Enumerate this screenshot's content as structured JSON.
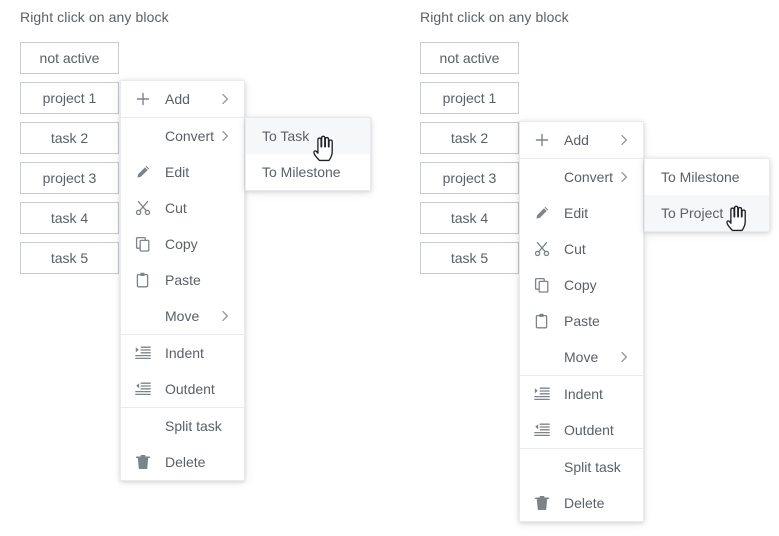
{
  "panels": [
    {
      "id": "left",
      "hint": "Right click on any block",
      "blocks": [
        {
          "label": "not active"
        },
        {
          "label": "project 1"
        },
        {
          "label": "task 2"
        },
        {
          "label": "project 3"
        },
        {
          "label": "task 4"
        },
        {
          "label": "task 5"
        }
      ],
      "menu": {
        "groups": [
          {
            "items": [
              {
                "label": "Add",
                "icon": "plus-icon",
                "arrow": true,
                "highlighted": false
              }
            ]
          },
          {
            "items": [
              {
                "label": "Convert",
                "icon": "none",
                "arrow": true,
                "highlighted": false
              },
              {
                "label": "Edit",
                "icon": "pencil-icon",
                "arrow": false,
                "highlighted": false
              },
              {
                "label": "Cut",
                "icon": "scissors-icon",
                "arrow": false,
                "highlighted": false
              },
              {
                "label": "Copy",
                "icon": "copy-icon",
                "arrow": false,
                "highlighted": false
              },
              {
                "label": "Paste",
                "icon": "clipboard-icon",
                "arrow": false,
                "highlighted": false
              },
              {
                "label": "Move",
                "icon": "none",
                "arrow": true,
                "highlighted": false
              }
            ]
          },
          {
            "items": [
              {
                "label": "Indent",
                "icon": "indent-icon",
                "arrow": false,
                "highlighted": false
              },
              {
                "label": "Outdent",
                "icon": "outdent-icon",
                "arrow": false,
                "highlighted": false
              }
            ]
          },
          {
            "items": [
              {
                "label": "Split task",
                "icon": "none",
                "arrow": false,
                "highlighted": false
              },
              {
                "label": "Delete",
                "icon": "trash-icon",
                "arrow": false,
                "highlighted": false
              }
            ]
          }
        ]
      },
      "submenu": {
        "parent": "Convert",
        "items": [
          {
            "label": "To Task",
            "highlighted": true
          },
          {
            "label": "To Milestone",
            "highlighted": false
          }
        ]
      },
      "cursor": {
        "icon": "pointing-hand-cursor",
        "on": "To Task"
      }
    },
    {
      "id": "right",
      "hint": "Right click on any block",
      "blocks": [
        {
          "label": "not active"
        },
        {
          "label": "project 1"
        },
        {
          "label": "task 2"
        },
        {
          "label": "project 3"
        },
        {
          "label": "task 4"
        },
        {
          "label": "task 5"
        }
      ],
      "menu": {
        "groups": [
          {
            "items": [
              {
                "label": "Add",
                "icon": "plus-icon",
                "arrow": true,
                "highlighted": false
              }
            ]
          },
          {
            "items": [
              {
                "label": "Convert",
                "icon": "none",
                "arrow": true,
                "highlighted": false
              },
              {
                "label": "Edit",
                "icon": "pencil-icon",
                "arrow": false,
                "highlighted": false
              },
              {
                "label": "Cut",
                "icon": "scissors-icon",
                "arrow": false,
                "highlighted": false
              },
              {
                "label": "Copy",
                "icon": "copy-icon",
                "arrow": false,
                "highlighted": false
              },
              {
                "label": "Paste",
                "icon": "clipboard-icon",
                "arrow": false,
                "highlighted": false
              },
              {
                "label": "Move",
                "icon": "none",
                "arrow": true,
                "highlighted": false
              }
            ]
          },
          {
            "items": [
              {
                "label": "Indent",
                "icon": "indent-icon",
                "arrow": false,
                "highlighted": false
              },
              {
                "label": "Outdent",
                "icon": "outdent-icon",
                "arrow": false,
                "highlighted": false
              }
            ]
          },
          {
            "items": [
              {
                "label": "Split task",
                "icon": "none",
                "arrow": false,
                "highlighted": false
              },
              {
                "label": "Delete",
                "icon": "trash-icon",
                "arrow": false,
                "highlighted": false
              }
            ]
          }
        ]
      },
      "submenu": {
        "parent": "Convert",
        "items": [
          {
            "label": "To Milestone",
            "highlighted": false
          },
          {
            "label": "To Project",
            "highlighted": true
          }
        ]
      },
      "cursor": {
        "icon": "pointing-hand-cursor",
        "on": "To Project"
      }
    }
  ],
  "colors": {
    "background": "#ffffff",
    "text": "#5a6066",
    "block_border": "#c8ccd0",
    "menu_border": "#e8eaed",
    "separator": "#e9ebee",
    "highlight": "#f6f7f9",
    "icon": "#7d8489"
  }
}
